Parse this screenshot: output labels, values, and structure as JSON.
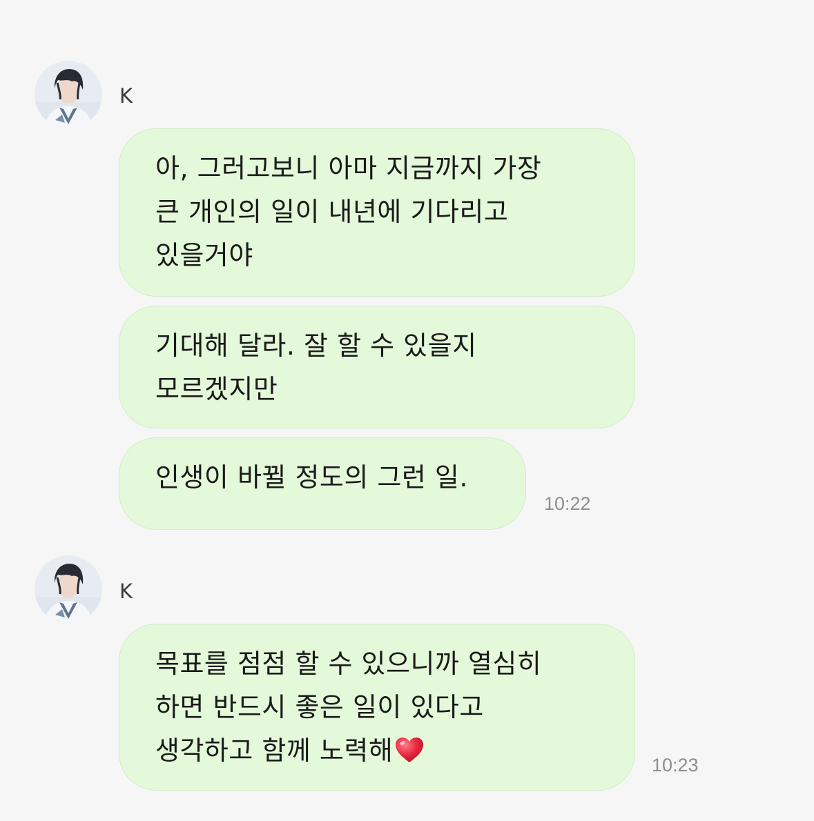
{
  "chat": {
    "groups": [
      {
        "sender": "K",
        "messages": [
          {
            "lines": [
              "아, 그러고보니 아마 지금까지 가장",
              "큰 개인의 일이 내년에 기다리고",
              "있을거야"
            ]
          },
          {
            "lines": [
              "기대해 달라. 잘 할 수 있을지",
              "모르겠지만"
            ]
          },
          {
            "lines": [
              "인생이 바뀔 정도의 그런 일."
            ],
            "time": "10:22"
          }
        ]
      },
      {
        "sender": "K",
        "messages": [
          {
            "lines": [
              "목표를 점점 할 수 있으니까 열심히",
              "하면 반드시 좋은 일이 있다고",
              "생각하고 함께 노력해"
            ],
            "time": "10:23",
            "emoji": "red-heart-icon"
          }
        ]
      }
    ]
  },
  "colors": {
    "background": "#f6f6f6",
    "bubble": "#e3f9da",
    "bubble_border": "#d3ebc8",
    "timestamp": "#8e8e8e",
    "heart": "#e8283f"
  }
}
